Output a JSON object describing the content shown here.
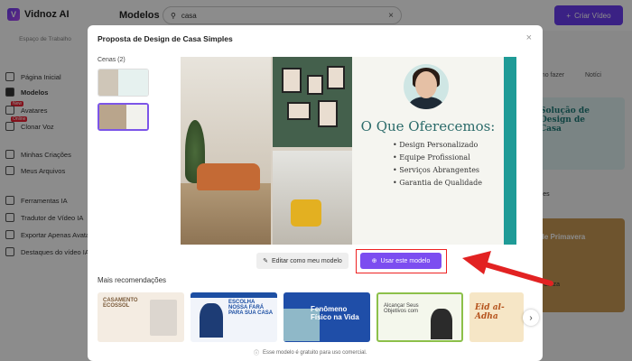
{
  "app": {
    "logo": "Vidnoz AI",
    "workspace": "Espaço de Trabalho",
    "sidebar": [
      {
        "label": "Página Inicial",
        "icon": "home-icon"
      },
      {
        "label": "Modelos",
        "icon": "template-icon",
        "active": true
      },
      {
        "label": "Avatares",
        "icon": "avatar-icon",
        "badge": "New"
      },
      {
        "label": "Clonar Voz",
        "icon": "voice-icon",
        "badge": "Online"
      },
      {
        "label": "Minhas Criações",
        "icon": "folder-icon"
      },
      {
        "label": "Meus Arquivos",
        "icon": "file-icon"
      },
      {
        "label": "Ferramentas IA",
        "icon": "tools-icon"
      },
      {
        "label": "Tradutor de Vídeo IA",
        "icon": "translate-icon"
      },
      {
        "label": "Exportar Apenas Avatar",
        "icon": "export-icon"
      },
      {
        "label": "Destaques do vídeo IA",
        "icon": "highlight-icon"
      }
    ],
    "header": {
      "title": "Modelos",
      "search_value": "casa",
      "create_label": "Criar Vídeo"
    },
    "bg_right": {
      "tab1": "omo fazer",
      "tab2": "Notíci",
      "card1_title": "Solução de Design de Casa",
      "card1_caption": "mples",
      "card2_title": "de Primavera",
      "card2_caption": "era Cinza"
    }
  },
  "modal": {
    "title": "Proposta de Design de Casa Simples",
    "scenes_label": "Cenas (2)",
    "slide": {
      "heading": "O Que Oferecemos:",
      "items": [
        "Design Personalizado",
        "Equipe Profissional",
        "Serviços Abrangentes",
        "Garantia de Qualidade"
      ]
    },
    "edit_label": "Editar como meu modelo",
    "use_label": "Usar este modelo",
    "more_label": "Mais recomendações",
    "recommendations": [
      {
        "text": "CASAMENTO ECOSSOL"
      },
      {
        "text": "ESCOLHA NOSSA FARÁ PARA SUA CASA"
      },
      {
        "text": "Fenômeno Físico na Vida"
      },
      {
        "text": "Alcançar Seus Objetivos com"
      },
      {
        "text": "Eid al-Adha"
      }
    ],
    "footer_note": "Esse modelo é gratuito para uso comercial."
  },
  "colors": {
    "accent": "#7c4df0",
    "teal": "#1f9b97",
    "highlight": "#e22222"
  }
}
